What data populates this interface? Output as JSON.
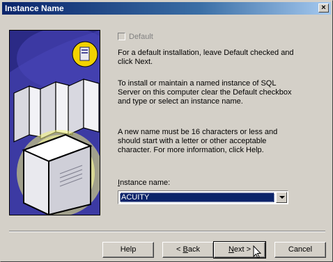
{
  "window": {
    "title": "Instance Name"
  },
  "default_checkbox": {
    "label": "Default",
    "checked": false,
    "enabled": false
  },
  "text": {
    "p1": "For a default installation, leave Default checked and click Next.",
    "p2": "To install or maintain a named instance of SQL Server on this computer clear the Default checkbox and type or select an instance name.",
    "p3": "A new name must be 16 characters or less and should start with a letter or other acceptable character.  For more information, click Help."
  },
  "instance": {
    "label_underlined": "I",
    "label_rest": "nstance name:",
    "value": "ACUITY"
  },
  "buttons": {
    "help": "Help",
    "back_u": "B",
    "back_pre": "< ",
    "back_rest": "ack",
    "next_u": "N",
    "next_rest": "ext >",
    "cancel": "Cancel"
  },
  "colors": {
    "title_bar": "#0a246a",
    "selection": "#0a246a",
    "face": "#d4d0c8"
  }
}
